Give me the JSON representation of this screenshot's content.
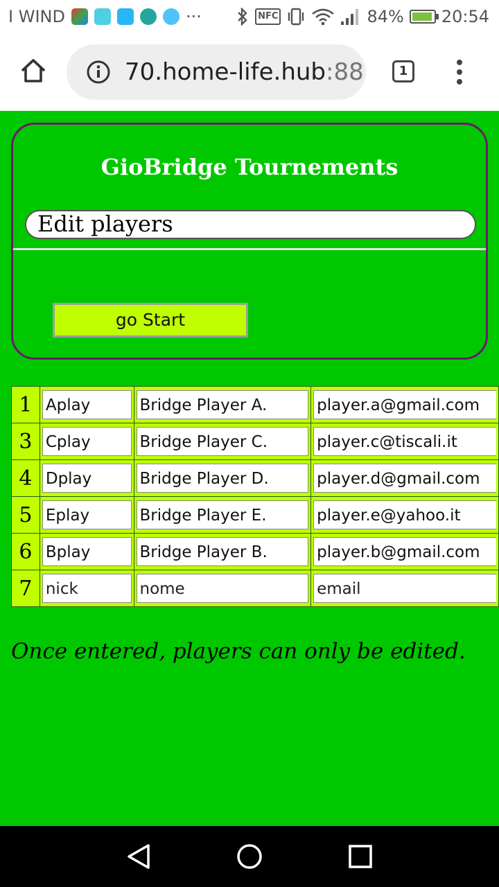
{
  "status_bar": {
    "carrier": "I WIND",
    "more_indicator": "···",
    "nfc_label": "NFC",
    "battery_percent": "84%",
    "battery_level": 0.84,
    "time": "20:54",
    "icons": [
      "app-notification-icon",
      "heart-notification-icon",
      "usb-icon",
      "globe-icon",
      "ghost-icon",
      "bluetooth-icon",
      "nfc-icon",
      "vibrate-icon",
      "wifi-icon",
      "signal-icon",
      "battery-charging-icon"
    ]
  },
  "browser": {
    "url_host": "70.home-life.hub",
    "url_port": ":88",
    "tab_count": "1"
  },
  "panel": {
    "title": "GioBridge Tournements",
    "section_label": "Edit players",
    "start_button": "go Start"
  },
  "players": [
    {
      "num": "1",
      "nick": "Aplay",
      "name": "Bridge Player A.",
      "email": "player.a@gmail.com"
    },
    {
      "num": "3",
      "nick": "Cplay",
      "name": "Bridge Player C.",
      "email": "player.c@tiscali.it"
    },
    {
      "num": "4",
      "nick": "Dplay",
      "name": "Bridge Player D.",
      "email": "player.d@gmail.com"
    },
    {
      "num": "5",
      "nick": "Eplay",
      "name": "Bridge Player E.",
      "email": "player.e@yahoo.it"
    },
    {
      "num": "6",
      "nick": "Bplay",
      "name": "Bridge Player B.",
      "email": "player.b@gmail.com"
    }
  ],
  "new_player": {
    "num": "7",
    "nick_placeholder": "nick",
    "name_placeholder": "nome",
    "email_placeholder": "email"
  },
  "footer_note": "Once entered, players can only be edited.",
  "colors": {
    "page_background": "#00c800",
    "accent_lime": "#bfff00",
    "panel_border": "#6a1b6a"
  }
}
